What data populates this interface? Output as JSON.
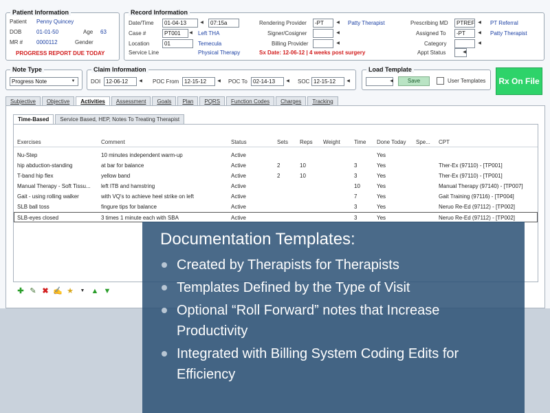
{
  "patient": {
    "legend": "Patient Information",
    "patient_label": "Patient",
    "patient_value": "Penny Quincey",
    "dob_label": "DOB",
    "dob_value": "01-01-50",
    "age_label": "Age",
    "age_value": "63",
    "mr_label": "MR #",
    "mr_value": "0000112",
    "gender_label": "Gender",
    "alert": "PROGRESS REPORT DUE TODAY"
  },
  "record": {
    "legend": "Record Information",
    "datetime_label": "Date/Time",
    "date_value": "01-04-13",
    "time_value": "07:15a",
    "case_label": "Case #",
    "case_value": "PT001",
    "case_desc": "Left THA",
    "location_label": "Location",
    "location_value": "01",
    "location_desc": "Temecula",
    "service_label": "Service Line",
    "service_desc": "Physical Therapy",
    "rendering_label": "Rendering Provider",
    "rendering_value": "-PT",
    "rendering_desc": "Patty Therapist",
    "signer_label": "Signer/Cosigner",
    "billing_label": "Billing Provider",
    "sx_date": "Sx Date: 12-06-12 | 4 weeks post surgery",
    "prescribing_label": "Prescribing MD",
    "prescribing_value": "PTREF",
    "prescribing_desc": "PT Referral",
    "assigned_label": "Assigned To",
    "assigned_value": "-PT",
    "assigned_desc": "Patty Therapist",
    "category_label": "Category",
    "appt_label": "Appt Status"
  },
  "note_type": {
    "legend": "Note Type",
    "value": "Progress Note"
  },
  "claim": {
    "legend": "Claim Information",
    "doi_label": "DOI",
    "doi_value": "12-06-12",
    "poc_from_label": "POC From",
    "poc_from_value": "12-15-12",
    "poc_to_label": "POC To",
    "poc_to_value": "02-14-13",
    "soc_label": "SOC",
    "soc_value": "12-15-12"
  },
  "load_template": {
    "legend": "Load Template",
    "save_label": "Save",
    "user_templates_label": "User Templates"
  },
  "rx_button": "Rx On File",
  "tabs": [
    "Subjective",
    "Objective",
    "Activities",
    "Assessment",
    "Goals",
    "Plan",
    "PQRS",
    "Function Codes",
    "Charges",
    "Tracking"
  ],
  "subtabs": [
    "Time-Based",
    "Service Based, HEP, Notes To Treating Therapist"
  ],
  "grid": {
    "headers": [
      "Exercises",
      "Comment",
      "Status",
      "Sets",
      "Reps",
      "Weight",
      "Time",
      "Done Today",
      "Spe...",
      "CPT"
    ],
    "rows": [
      [
        "Nu-Step",
        "10 minutes independent warm-up",
        "Active",
        "",
        "",
        "",
        "",
        "Yes",
        "",
        ""
      ],
      [
        "hip abduction-standing",
        "at bar for balance",
        "Active",
        "2",
        "10",
        "",
        "3",
        "Yes",
        "",
        "Ther-Ex (97110) - [TP001]"
      ],
      [
        "T-band hip flex",
        "yellow band",
        "Active",
        "2",
        "10",
        "",
        "3",
        "Yes",
        "",
        "Ther-Ex (97110) - [TP001]"
      ],
      [
        "Manual Therapy - Soft Tissu...",
        "left ITB and hamstring",
        "Active",
        "",
        "",
        "",
        "10",
        "Yes",
        "",
        "Manual Therapy (97140) - [TP007]"
      ],
      [
        "Gait - using rolling walker",
        "with VQ's to achieve heel strike on left",
        "Active",
        "",
        "",
        "",
        "7",
        "Yes",
        "",
        "Gait Training (97116) - [TP004]"
      ],
      [
        "SLB ball toss",
        "fingure tips for balance",
        "Active",
        "",
        "",
        "",
        "3",
        "Yes",
        "",
        "Neruo Re-Ed (97112) - [TP002]"
      ],
      [
        "SLB-eyes closed",
        "3 times 1 minute each with SBA",
        "Active",
        "",
        "",
        "",
        "3",
        "Yes",
        "",
        "Neruo Re-Ed (97112) - [TP002]"
      ]
    ]
  },
  "overlay": {
    "title": "Documentation Templates:",
    "items": [
      "Created by Therapists for Therapists",
      "Templates Defined by the Type of Visit",
      "Optional “Roll Forward” notes that Increase Productivity",
      "Integrated with Billing System Coding Edits for Efficiency"
    ]
  }
}
